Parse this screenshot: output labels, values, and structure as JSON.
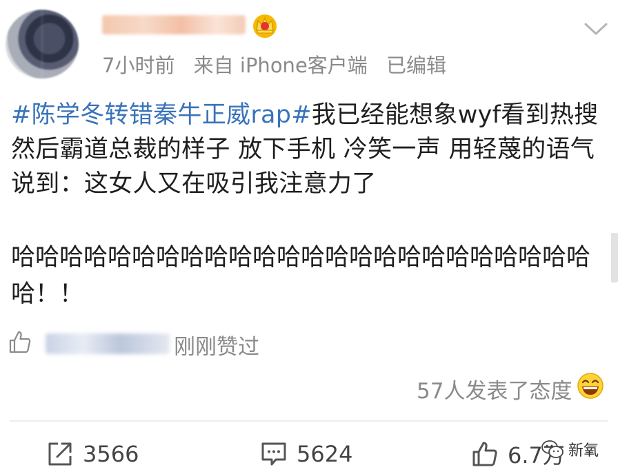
{
  "post": {
    "time": "7小时前",
    "source": "来自 iPhone客户端",
    "edited": "已编辑",
    "hashtag": "#陈学冬转错秦牛正威rap#",
    "text": "我已经能想象wyf看到热搜然后霸道总裁的样子 放下手机 冷笑一声 用轻蔑的语气说到：这女人又在吸引我注意力了",
    "laugh": "哈哈哈哈哈哈哈哈哈哈哈哈哈哈哈哈哈哈哈哈哈哈哈哈哈！！"
  },
  "liked": {
    "text": "刚刚赞过"
  },
  "attitude": {
    "text": "57人发表了态度"
  },
  "actions": {
    "repost_count": "3566",
    "comment_count": "5624",
    "like_count": "6.7万"
  },
  "watermark": {
    "label": "新氧"
  },
  "icons": {
    "crown": "crown-icon",
    "chevron": "chevron-down-icon",
    "like": "thumbs-up-icon",
    "repost": "repost-icon",
    "comment": "comment-icon",
    "grin": "grin-emoji-icon",
    "watermark": "wechat-icon"
  },
  "colors": {
    "hashtag": "#3a73ba",
    "meta": "#8a8a8a"
  }
}
